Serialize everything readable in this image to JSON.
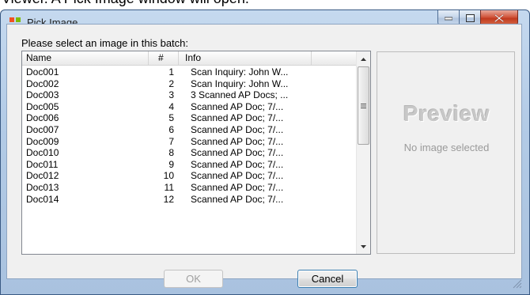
{
  "doc_text": "Viewer. A Pick Image window will open.",
  "window": {
    "title": "Pick Image",
    "controls": {
      "minimize": "minimize-icon",
      "maximize": "maximize-icon",
      "close": "close-icon"
    }
  },
  "prompt": "Please select an image in this batch:",
  "list": {
    "columns": {
      "name": "Name",
      "num": "#",
      "info": "Info"
    },
    "rows": [
      {
        "name": "Doc001",
        "num": "1",
        "info": "Scan Inquiry: John W..."
      },
      {
        "name": "Doc002",
        "num": "2",
        "info": "Scan Inquiry: John W..."
      },
      {
        "name": "Doc003",
        "num": "3",
        "info": "3 Scanned AP Docs; ..."
      },
      {
        "name": "Doc005",
        "num": "4",
        "info": "Scanned AP Doc; 7/..."
      },
      {
        "name": "Doc006",
        "num": "5",
        "info": "Scanned AP Doc; 7/..."
      },
      {
        "name": "Doc007",
        "num": "6",
        "info": "Scanned AP Doc; 7/..."
      },
      {
        "name": "Doc009",
        "num": "7",
        "info": "Scanned AP Doc; 7/..."
      },
      {
        "name": "Doc010",
        "num": "8",
        "info": "Scanned AP Doc; 7/..."
      },
      {
        "name": "Doc011",
        "num": "9",
        "info": "Scanned AP Doc; 7/..."
      },
      {
        "name": "Doc012",
        "num": "10",
        "info": "Scanned AP Doc; 7/..."
      },
      {
        "name": "Doc013",
        "num": "11",
        "info": "Scanned AP Doc; 7/..."
      },
      {
        "name": "Doc014",
        "num": "12",
        "info": "Scanned AP Doc; 7/..."
      }
    ]
  },
  "preview": {
    "title": "Preview",
    "subtitle": "No image selected"
  },
  "buttons": {
    "ok": "OK",
    "cancel": "Cancel"
  },
  "colors": {
    "titlebar": "#b9cfe8",
    "close_button": "#c8432a",
    "default_button_border": "#3c7fb1"
  }
}
